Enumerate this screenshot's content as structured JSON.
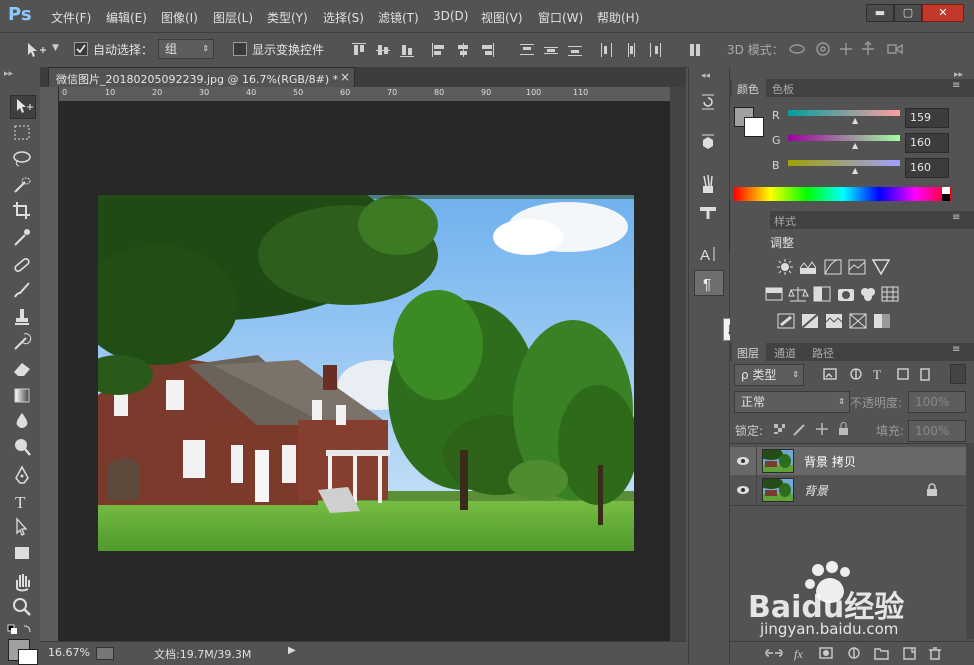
{
  "app": {
    "logo": "Ps"
  },
  "menu": [
    "文件(F)",
    "编辑(E)",
    "图像(I)",
    "图层(L)",
    "类型(Y)",
    "选择(S)",
    "滤镜(T)",
    "3D(D)",
    "视图(V)",
    "窗口(W)",
    "帮助(H)"
  ],
  "window_controls": {
    "minimize": "▬",
    "maximize": "▢",
    "close": "✕"
  },
  "options": {
    "auto_select_label": "自动选择：",
    "auto_select_value": "组",
    "show_transform_label": "显示变换控件",
    "mode_3d_label": "3D 模式："
  },
  "document": {
    "tab_title": "微信图片_20180205092239.jpg @ 16.7%(RGB/8#) *",
    "tab_close": "×",
    "ruler_ticks": [
      "0",
      "10",
      "20",
      "30",
      "40",
      "50",
      "60",
      "70",
      "80",
      "90",
      "100",
      "110"
    ]
  },
  "status": {
    "zoom": "16.67%",
    "doc_size": "文档:19.7M/39.3M",
    "arrow": "▶"
  },
  "color_panel": {
    "tabs": [
      "颜色",
      "色板"
    ],
    "channels": [
      {
        "label": "R",
        "value": "159",
        "gradient_start": "#009f9f",
        "gradient_end": "#ff9f9f"
      },
      {
        "label": "G",
        "value": "160",
        "gradient_start": "#9f00a0",
        "gradient_end": "#9fffa0"
      },
      {
        "label": "B",
        "value": "160",
        "gradient_start": "#9fa000",
        "gradient_end": "#9fa0ff"
      }
    ],
    "foreground": "#9fa0a0",
    "background": "#ffffff"
  },
  "adjust_panel": {
    "tab_partial": "样式",
    "title_partial": "调整",
    "tooltip": "段落"
  },
  "layers_panel": {
    "tabs": [
      "图层",
      "通道",
      "路径"
    ],
    "filter_label": "ρ 类型",
    "blend_mode": "正常",
    "opacity_label": "不透明度:",
    "opacity_value": "100%",
    "lock_label": "锁定:",
    "fill_label": "填充:",
    "fill_value": "100%",
    "layers": [
      {
        "name": "背景 拷贝",
        "locked": false
      },
      {
        "name": "背景",
        "locked": true
      }
    ]
  },
  "watermark": {
    "brand": "Baidu经验",
    "url": "jingyan.baidu.com"
  }
}
